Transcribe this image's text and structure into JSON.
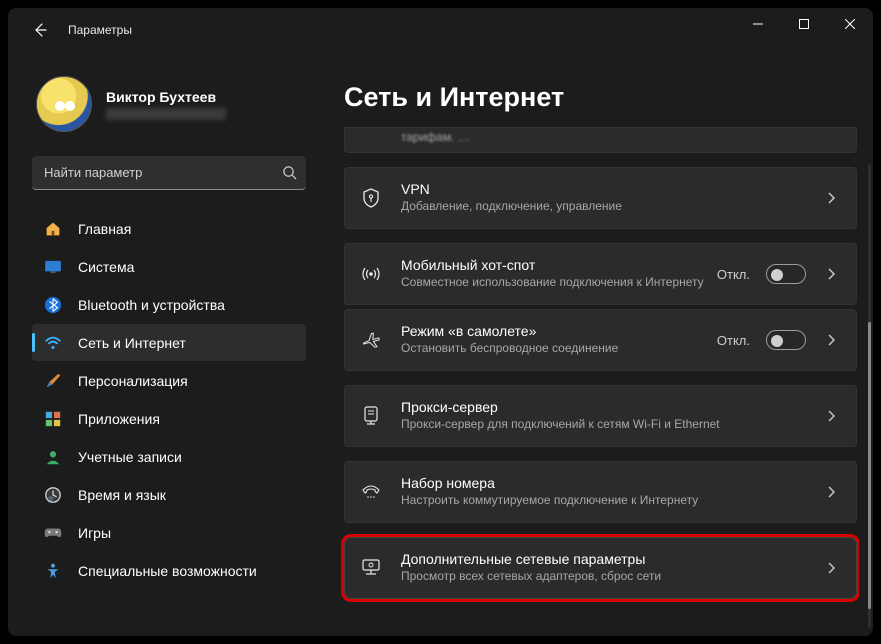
{
  "window": {
    "title": "Параметры"
  },
  "profile": {
    "name": "Виктор Бухтеев"
  },
  "search": {
    "placeholder": "Найти параметр"
  },
  "sidebar": {
    "items": [
      {
        "id": "home",
        "label": "Главная"
      },
      {
        "id": "system",
        "label": "Система"
      },
      {
        "id": "bluetooth",
        "label": "Bluetooth и устройства"
      },
      {
        "id": "network",
        "label": "Сеть и Интернет",
        "active": true
      },
      {
        "id": "personalization",
        "label": "Персонализация"
      },
      {
        "id": "apps",
        "label": "Приложения"
      },
      {
        "id": "accounts",
        "label": "Учетные записи"
      },
      {
        "id": "time",
        "label": "Время и язык"
      },
      {
        "id": "gaming",
        "label": "Игры"
      },
      {
        "id": "accessibility",
        "label": "Специальные возможности"
      }
    ]
  },
  "main": {
    "title": "Сеть и Интернет",
    "panels": {
      "vpn": {
        "title": "VPN",
        "sub": "Добавление, подключение, управление"
      },
      "hotspot": {
        "title": "Мобильный хот-спот",
        "sub": "Совместное использование подключения к Интернету",
        "state": "Откл."
      },
      "airplane": {
        "title": "Режим «в самолете»",
        "sub": "Остановить беспроводное соединение",
        "state": "Откл."
      },
      "proxy": {
        "title": "Прокси-сервер",
        "sub": "Прокси-сервер для подключений к сетям Wi-Fi и Ethernet"
      },
      "dialup": {
        "title": "Набор номера",
        "sub": "Настроить коммутируемое подключение к Интернету"
      },
      "advanced": {
        "title": "Дополнительные сетевые параметры",
        "sub": "Просмотр всех сетевых адаптеров, сброс сети"
      }
    }
  }
}
